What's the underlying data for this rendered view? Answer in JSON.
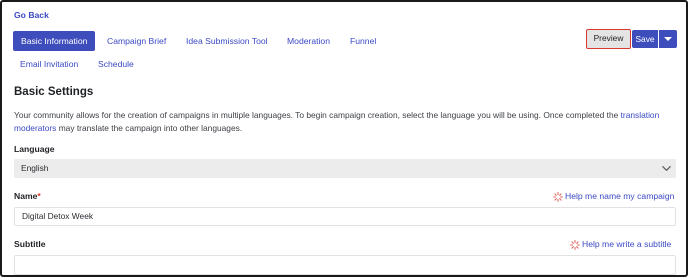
{
  "nav": {
    "go_back": "Go Back"
  },
  "tabs": [
    {
      "label": "Basic Information",
      "active": true
    },
    {
      "label": "Campaign Brief"
    },
    {
      "label": "Idea Submission Tool"
    },
    {
      "label": "Moderation"
    },
    {
      "label": "Funnel"
    },
    {
      "label": "Email Invitation"
    },
    {
      "label": "Schedule"
    }
  ],
  "actions": {
    "preview": "Preview",
    "save": "Save"
  },
  "section": {
    "title": "Basic Settings",
    "description_start": "Your community allows for the creation of campaigns in multiple languages. To begin campaign creation, select the language you will be using. Once completed the",
    "description_link": "translation moderators",
    "description_end": "may translate the campaign into other languages."
  },
  "fields": {
    "language": {
      "label": "Language",
      "value": "English"
    },
    "name": {
      "label": "Name",
      "required_mark": "*",
      "value": "Digital Detox Week",
      "help": "Help me name my campaign"
    },
    "subtitle": {
      "label": "Subtitle",
      "value": "",
      "help": "Help me write a subtitle"
    }
  },
  "colors": {
    "accent": "#3d4dbc",
    "link": "#3b49c4",
    "highlight": "#d93a30",
    "sparkle": "#e06b63"
  },
  "icons": {
    "select_chevron": "chevron-down-icon",
    "help_sparkle": "sparkle-icon"
  }
}
